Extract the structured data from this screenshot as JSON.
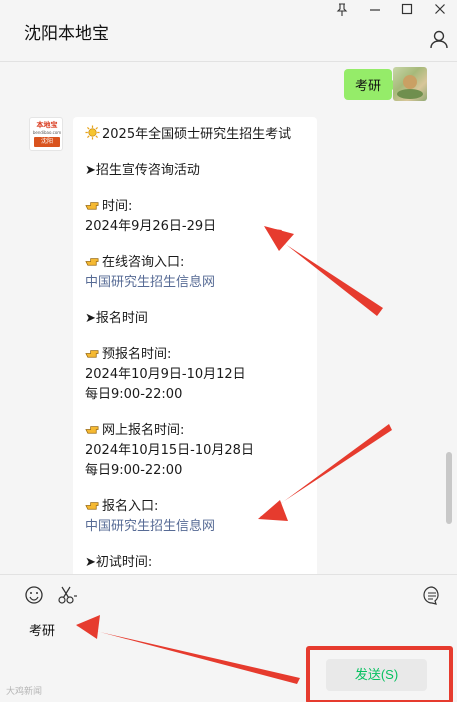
{
  "window": {
    "title": "沈阳本地宝",
    "controls": {
      "pin": "⊼",
      "minimize": "—",
      "maximize": "☐",
      "close": "✕"
    }
  },
  "chat": {
    "me": {
      "message": "考研",
      "avatar_icon": "user-avatar-image"
    },
    "bot": {
      "avatar": {
        "logo_text": "本地宝",
        "logo_sub": "bendibao.com",
        "logo_city": "沈阳"
      },
      "lines": {
        "l0": "2025年全国硕士研究生招生考试",
        "l1": "➤招生宣传咨询活动",
        "l2": "时间:",
        "l3": "2024年9月26日-29日",
        "l4": "在线咨询入口:",
        "l5": "中国研究生招生信息网",
        "l6": "➤报名时间",
        "l7": "预报名时间:",
        "l8": "2024年10月9日-10月12日",
        "l9": "每日9:00-22:00",
        "l10": "网上报名时间:",
        "l11": "2024年10月15日-10月28日",
        "l12": "每日9:00-22:00",
        "l13": "报名入口:",
        "l14": "中国研究生招生信息网",
        "l15": "➤初试时间:"
      }
    }
  },
  "input": {
    "text": "考研",
    "send_label": "发送(S)",
    "icons": [
      "emoji-icon",
      "scissors-icon",
      "chat-history-icon"
    ]
  },
  "watermark": "大鸡新闻",
  "colors": {
    "send_text": "#07c160",
    "my_bubble": "#95ec69",
    "link": "#576b95",
    "annotation_red": "#e63b2e"
  }
}
